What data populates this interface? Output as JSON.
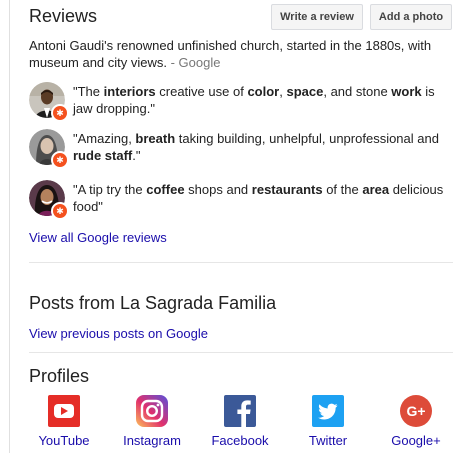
{
  "reviews": {
    "heading": "Reviews",
    "write_button": "Write a review",
    "add_photo_button": "Add a photo",
    "summary": "Antoni Gaudi's renowned unfinished church, started in the 1880s, with museum and city views.",
    "summary_source": " - Google",
    "items": [
      {
        "parts": [
          {
            "t": "\"The ",
            "b": false
          },
          {
            "t": "interiors",
            "b": true
          },
          {
            "t": " creative use of ",
            "b": false
          },
          {
            "t": "color",
            "b": true
          },
          {
            "t": ", ",
            "b": false
          },
          {
            "t": "space",
            "b": true
          },
          {
            "t": ", and stone ",
            "b": false
          },
          {
            "t": "work",
            "b": true
          },
          {
            "t": " is jaw dropping.\"",
            "b": false
          }
        ]
      },
      {
        "parts": [
          {
            "t": "\"Amazing, ",
            "b": false
          },
          {
            "t": "breath",
            "b": true
          },
          {
            "t": " taking building, unhelpful, unprofessional and ",
            "b": false
          },
          {
            "t": "rude staff",
            "b": true
          },
          {
            "t": ".\"",
            "b": false
          }
        ]
      },
      {
        "parts": [
          {
            "t": "\"A tip try the ",
            "b": false
          },
          {
            "t": "coffee",
            "b": true
          },
          {
            "t": " shops and ",
            "b": false
          },
          {
            "t": "restaurants",
            "b": true
          },
          {
            "t": " of the ",
            "b": false
          },
          {
            "t": "area",
            "b": true
          },
          {
            "t": " delicious food\"",
            "b": false
          }
        ]
      }
    ],
    "view_all": "View all Google reviews"
  },
  "posts": {
    "heading": "Posts from La Sagrada Familia",
    "view_previous": "View previous posts on Google"
  },
  "profiles": {
    "heading": "Profiles",
    "items": [
      {
        "label": "YouTube",
        "icon": "youtube-icon",
        "color": "#e52d27"
      },
      {
        "label": "Instagram",
        "icon": "instagram-icon",
        "color": "#c13584"
      },
      {
        "label": "Facebook",
        "icon": "facebook-icon",
        "color": "#3b5998"
      },
      {
        "label": "Twitter",
        "icon": "twitter-icon",
        "color": "#1da1f2"
      },
      {
        "label": "Google+",
        "icon": "google-plus-icon",
        "color": "#dd4b39"
      }
    ]
  },
  "colors": {
    "link": "#1a0dab",
    "badge": "#f4511e"
  }
}
